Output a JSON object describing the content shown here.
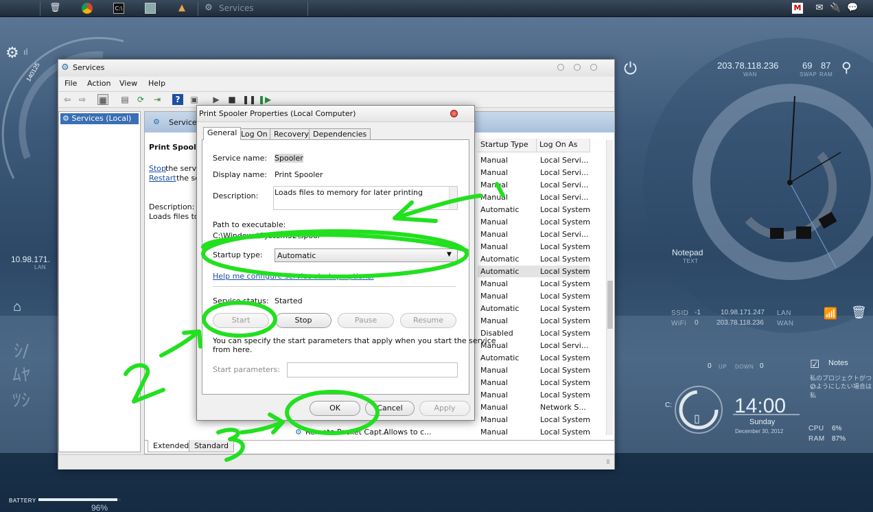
{
  "taskbar": {
    "active_window_label": "Services",
    "icons": [
      "apple-icon",
      "trash-icon",
      "chrome-icon",
      "cmd-icon",
      "image-icon",
      "lock-icon"
    ],
    "tray_icons": [
      "antivirus-icon",
      "mail-icon",
      "power-plug-icon",
      "speech-icon"
    ]
  },
  "desktop": {
    "wan_ip": "203.78.118.236",
    "wan_label": "WAN",
    "swap_value": "69",
    "ram_value": "87",
    "swap_label": "SWAP",
    "ram_label": "RAM",
    "lan_ip": "10.98.171.",
    "lan_label": "LAN",
    "notepad_label": "Notepad",
    "notepad_sub": "TEXT",
    "ssid_label": "SSID",
    "ssid_value": "-1",
    "wifi_label": "WiFi",
    "wifi_value": "0",
    "net_lan_ip": "10.98.171.247",
    "net_lan_label": "LAN",
    "net_wan_ip": "203.78.118.236",
    "net_wan_label": "WAN",
    "up_value": "0",
    "up_label": "UP",
    "down_label": "DOWN",
    "down_value": "0",
    "notes_label": "Notes",
    "notes_line1": "私のプロジェクトがつい",
    "notes_line2": "のようにしたい場合は私",
    "drive_label": "C:",
    "time": "14:00",
    "day": "Sunday",
    "date": "December 30, 2012",
    "cpu_label": "CPU",
    "cpu_value": "6%",
    "ram_label2": "RAM",
    "ram_value2": "87%",
    "battery_label": "BATTERY",
    "battery_value": "96%",
    "battery_level": 0.96,
    "widget_number": "140125"
  },
  "services_window": {
    "title": "Services",
    "menu": [
      "File",
      "Action",
      "View",
      "Help"
    ],
    "tree_item": "Services (Local)",
    "panel_header": "Services",
    "selected_service": "Print Spooler",
    "link_stop": "Stop",
    "link_stop_rest": " the servic",
    "link_restart": "Restart",
    "link_restart_rest": " the se",
    "description_label": "Description:",
    "description_text": "Loads files to",
    "columns": [
      "Startup Type",
      "Log On As"
    ],
    "rows": [
      [
        "Manual",
        "Local Servi..."
      ],
      [
        "Manual",
        "Local Servi..."
      ],
      [
        "Manual",
        "Local Servi..."
      ],
      [
        "Manual",
        "Local Servi..."
      ],
      [
        "Automatic",
        "Local System"
      ],
      [
        "Manual",
        "Local System"
      ],
      [
        "Manual",
        "Local Servi..."
      ],
      [
        "Manual",
        "Local System"
      ],
      [
        "Automatic",
        "Local System"
      ],
      [
        "Automatic",
        "Local System"
      ],
      [
        "Manual",
        "Local System"
      ],
      [
        "Manual",
        "Local System"
      ],
      [
        "Automatic",
        "Local System"
      ],
      [
        "Manual",
        "Local System"
      ],
      [
        "Disabled",
        "Local System"
      ],
      [
        "Manual",
        "Local Servi..."
      ],
      [
        "Automatic",
        "Local System"
      ],
      [
        "Manual",
        "Local System"
      ],
      [
        "Manual",
        "Local System"
      ],
      [
        "Manual",
        "Local System"
      ],
      [
        "Manual",
        "Network S..."
      ],
      [
        "Manual",
        "Local System"
      ],
      [
        "Manual",
        "Local System"
      ]
    ],
    "partial_row_name": "Remote Packet Capt...",
    "partial_row_desc": "Allows to c...",
    "bottom_tabs": [
      "Extended",
      "Standard"
    ]
  },
  "dialog": {
    "title": "Print Spooler Properties (Local Computer)",
    "tabs": [
      "General",
      "Log On",
      "Recovery",
      "Dependencies"
    ],
    "service_name_label": "Service name:",
    "service_name_value": "Spooler",
    "display_name_label": "Display name:",
    "display_name_value": "Print Spooler",
    "description_label": "Description:",
    "description_value": "Loads files to memory for later printing",
    "path_label": "Path to executable:",
    "path_value": "C:\\Windows\\System32\\spool",
    "startup_type_label": "Startup type:",
    "startup_type_value": "Automatic",
    "help_link": "Help me configure service startup options.",
    "status_label": "Service status:",
    "status_value": "Started",
    "buttons": {
      "start": "Start",
      "stop": "Stop",
      "pause": "Pause",
      "resume": "Resume"
    },
    "hint": "You can specify the start parameters that apply when you start the service",
    "hint2": "from here.",
    "start_params_label": "Start parameters:",
    "ok": "OK",
    "cancel": "Cancel",
    "apply": "Apply"
  },
  "annotations": {
    "color": "#22e01f",
    "labels": [
      "1",
      "2",
      "3"
    ]
  }
}
